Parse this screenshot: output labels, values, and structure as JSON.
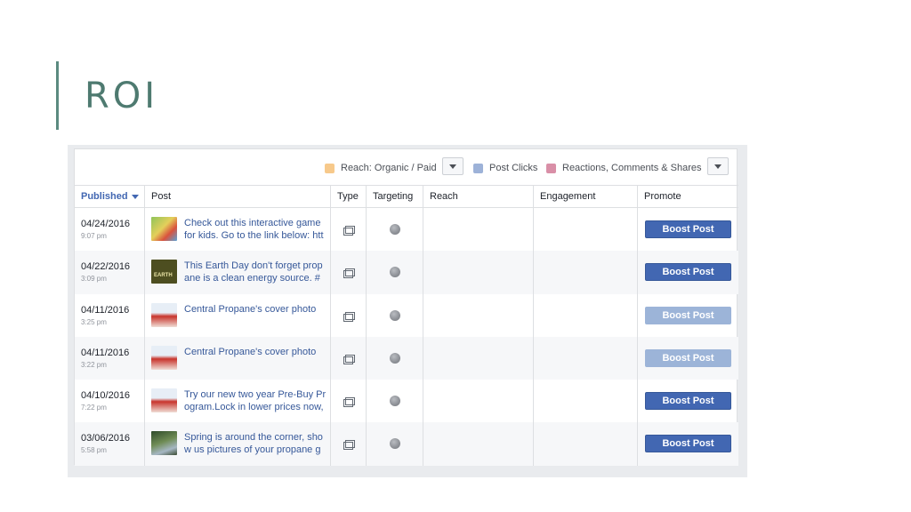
{
  "slide": {
    "title": "ROI"
  },
  "toolbar": {
    "legend": [
      {
        "label": "Reach: Organic / Paid",
        "color": "#f7c98b"
      },
      {
        "label": "Post Clicks",
        "color": "#9db2d8"
      },
      {
        "label": "Reactions, Comments & Shares",
        "color": "#d98fa7"
      }
    ]
  },
  "table": {
    "columns": [
      "Published",
      "Post",
      "Type",
      "Targeting",
      "Reach",
      "Engagement",
      "Promote"
    ],
    "rows": [
      {
        "date": "04/24/2016",
        "time": "9:07 pm",
        "post": "Check out this interactive game for kids. Go to the link below: htt",
        "thumb": "game",
        "button": "Boost Post",
        "disabled": false
      },
      {
        "date": "04/22/2016",
        "time": "3:09 pm",
        "post": "This Earth Day don't forget prop ane is a clean energy source. #",
        "thumb": "earth",
        "button": "Boost Post",
        "disabled": false
      },
      {
        "date": "04/11/2016",
        "time": "3:25 pm",
        "post": "Central Propane's cover photo",
        "thumb": "propane",
        "button": "Boost Post",
        "disabled": true
      },
      {
        "date": "04/11/2016",
        "time": "3:22 pm",
        "post": "Central Propane's cover photo",
        "thumb": "propane",
        "button": "Boost Post",
        "disabled": true
      },
      {
        "date": "04/10/2016",
        "time": "7:22 pm",
        "post": "Try our new two year Pre-Buy Pr ogram.Lock in lower prices now,",
        "thumb": "propane",
        "button": "Boost Post",
        "disabled": false
      },
      {
        "date": "03/06/2016",
        "time": "5:58 pm",
        "post": "Spring is around the corner, sho w us pictures of your propane g",
        "thumb": "spring",
        "button": "Boost Post",
        "disabled": false
      }
    ]
  }
}
